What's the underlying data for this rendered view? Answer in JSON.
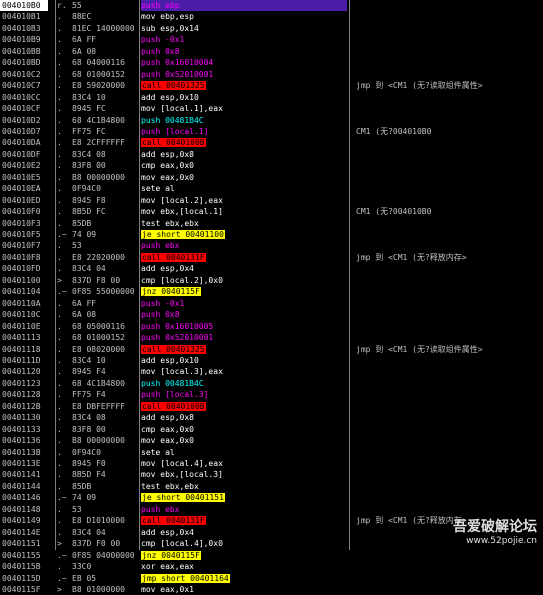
{
  "rows": [
    {
      "addr": "004010B0",
      "flow": "r.",
      "hex": "55",
      "mnem": "push ebp",
      "kind": "pushpop",
      "comment": "",
      "selected": true
    },
    {
      "addr": "004010B1",
      "flow": ".",
      "hex": "8BEC",
      "mnem": "mov ebp,esp",
      "kind": "normal",
      "comment": ""
    },
    {
      "addr": "004010B3",
      "flow": ".",
      "hex": "81EC 14000000",
      "mnem": "sub esp,0x14",
      "kind": "normal",
      "comment": ""
    },
    {
      "addr": "004010B9",
      "flow": ".",
      "hex": "6A FF",
      "mnem": "push -0x1",
      "kind": "pushpop",
      "comment": ""
    },
    {
      "addr": "004010BB",
      "flow": ".",
      "hex": "6A 08",
      "mnem": "push 0x8",
      "kind": "pushpop",
      "comment": ""
    },
    {
      "addr": "004010BD",
      "flow": ".",
      "hex": "68 04000116",
      "mnem": "push 0x16010004",
      "kind": "pushpop",
      "comment": ""
    },
    {
      "addr": "004010C2",
      "flow": ".",
      "hex": "68 01000152",
      "mnem": "push 0x52010001",
      "kind": "pushpop",
      "comment": ""
    },
    {
      "addr": "004010C7",
      "flow": ".",
      "hex": "E8 59020000",
      "mnem": "call 00401325",
      "kind": "call",
      "comment": "jmp 到 <CM1 (无?读取组件属性>"
    },
    {
      "addr": "004010CC",
      "flow": ".",
      "hex": "83C4 10",
      "mnem": "add esp,0x10",
      "kind": "normal",
      "comment": ""
    },
    {
      "addr": "004010CF",
      "flow": ".",
      "hex": "8945 FC",
      "mnem": "mov [local.1],eax",
      "kind": "normal",
      "comment": ""
    },
    {
      "addr": "004010D2",
      "flow": ".",
      "hex": "68 4C1B4800",
      "mnem": "push 00481B4C",
      "kind": "cyanpush",
      "comment": ""
    },
    {
      "addr": "004010D7",
      "flow": ".",
      "hex": "FF75 FC",
      "mnem": "push [local.1]",
      "kind": "pushpop",
      "comment": "CM1 (无?004010B0"
    },
    {
      "addr": "004010DA",
      "flow": ".",
      "hex": "E8 2CFFFFFF",
      "mnem": "call 0040100B",
      "kind": "call",
      "comment": ""
    },
    {
      "addr": "004010DF",
      "flow": ".",
      "hex": "83C4 08",
      "mnem": "add esp,0x8",
      "kind": "normal",
      "comment": ""
    },
    {
      "addr": "004010E2",
      "flow": ".",
      "hex": "83F8 00",
      "mnem": "cmp eax,0x0",
      "kind": "normal",
      "comment": ""
    },
    {
      "addr": "004010E5",
      "flow": ".",
      "hex": "B8 00000000",
      "mnem": "mov eax,0x0",
      "kind": "normal",
      "comment": ""
    },
    {
      "addr": "004010EA",
      "flow": ".",
      "hex": "0F94C0",
      "mnem": "sete al",
      "kind": "normal",
      "comment": ""
    },
    {
      "addr": "004010ED",
      "flow": ".",
      "hex": "8945 F8",
      "mnem": "mov [local.2],eax",
      "kind": "normal",
      "comment": ""
    },
    {
      "addr": "004010F0",
      "flow": ".",
      "hex": "8B5D FC",
      "mnem": "mov ebx,[local.1]",
      "kind": "normal",
      "comment": "CM1 (无?004010B0"
    },
    {
      "addr": "004010F3",
      "flow": ".",
      "hex": "85DB",
      "mnem": "test ebx,ebx",
      "kind": "normal",
      "comment": ""
    },
    {
      "addr": "004010F5",
      "flow": ".~",
      "hex": "74 09",
      "mnem": "je short 00401100",
      "kind": "jcc",
      "comment": ""
    },
    {
      "addr": "004010F7",
      "flow": ".",
      "hex": "53",
      "mnem": "push ebx",
      "kind": "pushpop",
      "comment": ""
    },
    {
      "addr": "004010F8",
      "flow": ".",
      "hex": "E8 22020000",
      "mnem": "call 0040131F",
      "kind": "call",
      "comment": "jmp 到 <CM1 (无?释放内存>"
    },
    {
      "addr": "004010FD",
      "flow": ".",
      "hex": "83C4 04",
      "mnem": "add esp,0x4",
      "kind": "normal",
      "comment": ""
    },
    {
      "addr": "00401100",
      "flow": ">",
      "hex": "837D F8 00",
      "mnem": "cmp [local.2],0x0",
      "kind": "normal",
      "comment": ""
    },
    {
      "addr": "00401104",
      "flow": ".~",
      "hex": "0F85 55000000",
      "mnem": "jnz 0040115F",
      "kind": "jcc",
      "comment": ""
    },
    {
      "addr": "0040110A",
      "flow": ".",
      "hex": "6A FF",
      "mnem": "push -0x1",
      "kind": "pushpop",
      "comment": ""
    },
    {
      "addr": "0040110C",
      "flow": ".",
      "hex": "6A 08",
      "mnem": "push 0x8",
      "kind": "pushpop",
      "comment": ""
    },
    {
      "addr": "0040110E",
      "flow": ".",
      "hex": "68 05000116",
      "mnem": "push 0x16010005",
      "kind": "pushpop",
      "comment": ""
    },
    {
      "addr": "00401113",
      "flow": ".",
      "hex": "68 01000152",
      "mnem": "push 0x52010001",
      "kind": "pushpop",
      "comment": ""
    },
    {
      "addr": "00401118",
      "flow": ".",
      "hex": "E8 08020000",
      "mnem": "call 00401325",
      "kind": "call",
      "comment": "jmp 到 <CM1 (无?读取组件属性>"
    },
    {
      "addr": "0040111D",
      "flow": ".",
      "hex": "83C4 10",
      "mnem": "add esp,0x10",
      "kind": "normal",
      "comment": ""
    },
    {
      "addr": "00401120",
      "flow": ".",
      "hex": "8945 F4",
      "mnem": "mov [local.3],eax",
      "kind": "normal",
      "comment": ""
    },
    {
      "addr": "00401123",
      "flow": ".",
      "hex": "68 4C1B4800",
      "mnem": "push 00481B4C",
      "kind": "cyanpush",
      "comment": ""
    },
    {
      "addr": "00401128",
      "flow": ".",
      "hex": "FF75 F4",
      "mnem": "push [local.3]",
      "kind": "pushpop",
      "comment": ""
    },
    {
      "addr": "0040112B",
      "flow": ".",
      "hex": "E8 DBFEFFFF",
      "mnem": "call 0040100B",
      "kind": "call",
      "comment": ""
    },
    {
      "addr": "00401130",
      "flow": ".",
      "hex": "83C4 08",
      "mnem": "add esp,0x8",
      "kind": "normal",
      "comment": ""
    },
    {
      "addr": "00401133",
      "flow": ".",
      "hex": "83F8 00",
      "mnem": "cmp eax,0x0",
      "kind": "normal",
      "comment": ""
    },
    {
      "addr": "00401136",
      "flow": ".",
      "hex": "B8 00000000",
      "mnem": "mov eax,0x0",
      "kind": "normal",
      "comment": ""
    },
    {
      "addr": "0040113B",
      "flow": ".",
      "hex": "0F94C0",
      "mnem": "sete al",
      "kind": "normal",
      "comment": ""
    },
    {
      "addr": "0040113E",
      "flow": ".",
      "hex": "8945 F0",
      "mnem": "mov [local.4],eax",
      "kind": "normal",
      "comment": ""
    },
    {
      "addr": "00401141",
      "flow": ".",
      "hex": "8B5D F4",
      "mnem": "mov ebx,[local.3]",
      "kind": "normal",
      "comment": ""
    },
    {
      "addr": "00401144",
      "flow": ".",
      "hex": "85DB",
      "mnem": "test ebx,ebx",
      "kind": "normal",
      "comment": ""
    },
    {
      "addr": "00401146",
      "flow": ".~",
      "hex": "74 09",
      "mnem": "je short 00401151",
      "kind": "jcc",
      "comment": ""
    },
    {
      "addr": "00401148",
      "flow": ".",
      "hex": "53",
      "mnem": "push ebx",
      "kind": "pushpop",
      "comment": ""
    },
    {
      "addr": "00401149",
      "flow": ".",
      "hex": "E8 D1010000",
      "mnem": "call 0040131F",
      "kind": "call",
      "comment": "jmp 到 <CM1 (无?释放内存>"
    },
    {
      "addr": "0040114E",
      "flow": ".",
      "hex": "83C4 04",
      "mnem": "add esp,0x4",
      "kind": "normal",
      "comment": ""
    },
    {
      "addr": "00401151",
      "flow": ">",
      "hex": "837D F0 00",
      "mnem": "cmp [local.4],0x0",
      "kind": "normal",
      "comment": ""
    },
    {
      "addr": "00401155",
      "flow": ".~",
      "hex": "0F85 04000000",
      "mnem": "jnz 0040115F",
      "kind": "jcc",
      "comment": ""
    },
    {
      "addr": "0040115B",
      "flow": ".",
      "hex": "33C0",
      "mnem": "xor eax,eax",
      "kind": "normal",
      "comment": ""
    },
    {
      "addr": "0040115D",
      "flow": ".~",
      "hex": "EB 05",
      "mnem": "jmp short 00401164",
      "kind": "jmp",
      "comment": ""
    },
    {
      "addr": "0040115F",
      "flow": ">",
      "hex": "B8 01000000",
      "mnem": "mov eax,0x1",
      "kind": "normal",
      "comment": ""
    }
  ],
  "watermark": {
    "title": "吾爱破解论坛",
    "url": "www.52pojie.cn"
  }
}
